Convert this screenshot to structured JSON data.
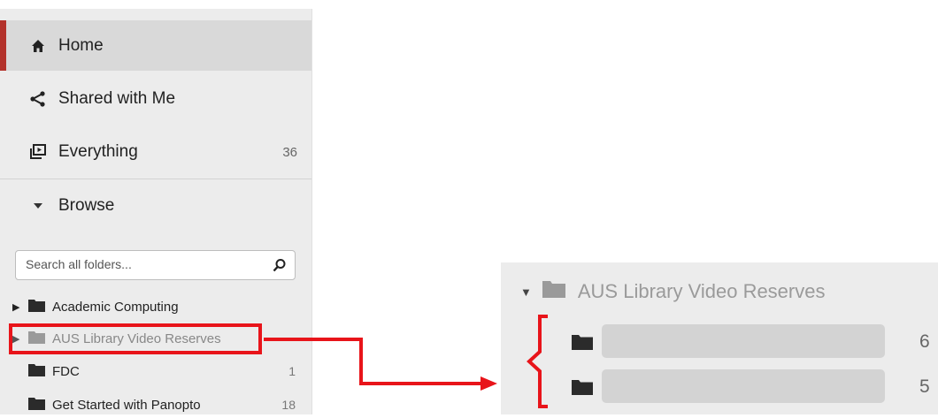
{
  "sidebar": {
    "nav": [
      {
        "label": "Home",
        "icon": "home-icon"
      },
      {
        "label": "Shared with Me",
        "icon": "share-icon"
      },
      {
        "label": "Everything",
        "icon": "video-library-icon",
        "count": "36"
      },
      {
        "label": "Browse",
        "icon": "caret-down-icon"
      }
    ],
    "search_placeholder": "Search all folders...",
    "folders": [
      {
        "label": "Academic Computing",
        "expandable": true,
        "count": ""
      },
      {
        "label": "AUS Library Video Reserves",
        "expandable": true,
        "count": "",
        "highlighted": true
      },
      {
        "label": "FDC",
        "expandable": false,
        "count": "1"
      },
      {
        "label": "Get Started with Panopto",
        "expandable": false,
        "count": "18"
      }
    ]
  },
  "detail": {
    "title": "AUS Library Video Reserves",
    "rows": [
      {
        "count": "6",
        "name_redacted": true
      },
      {
        "count": "5",
        "name_redacted": true
      }
    ]
  },
  "colors": {
    "accent": "#b3322b",
    "callout": "#e8141a",
    "sidebar_bg": "#ececec",
    "active_bg": "#d9d9d9"
  }
}
